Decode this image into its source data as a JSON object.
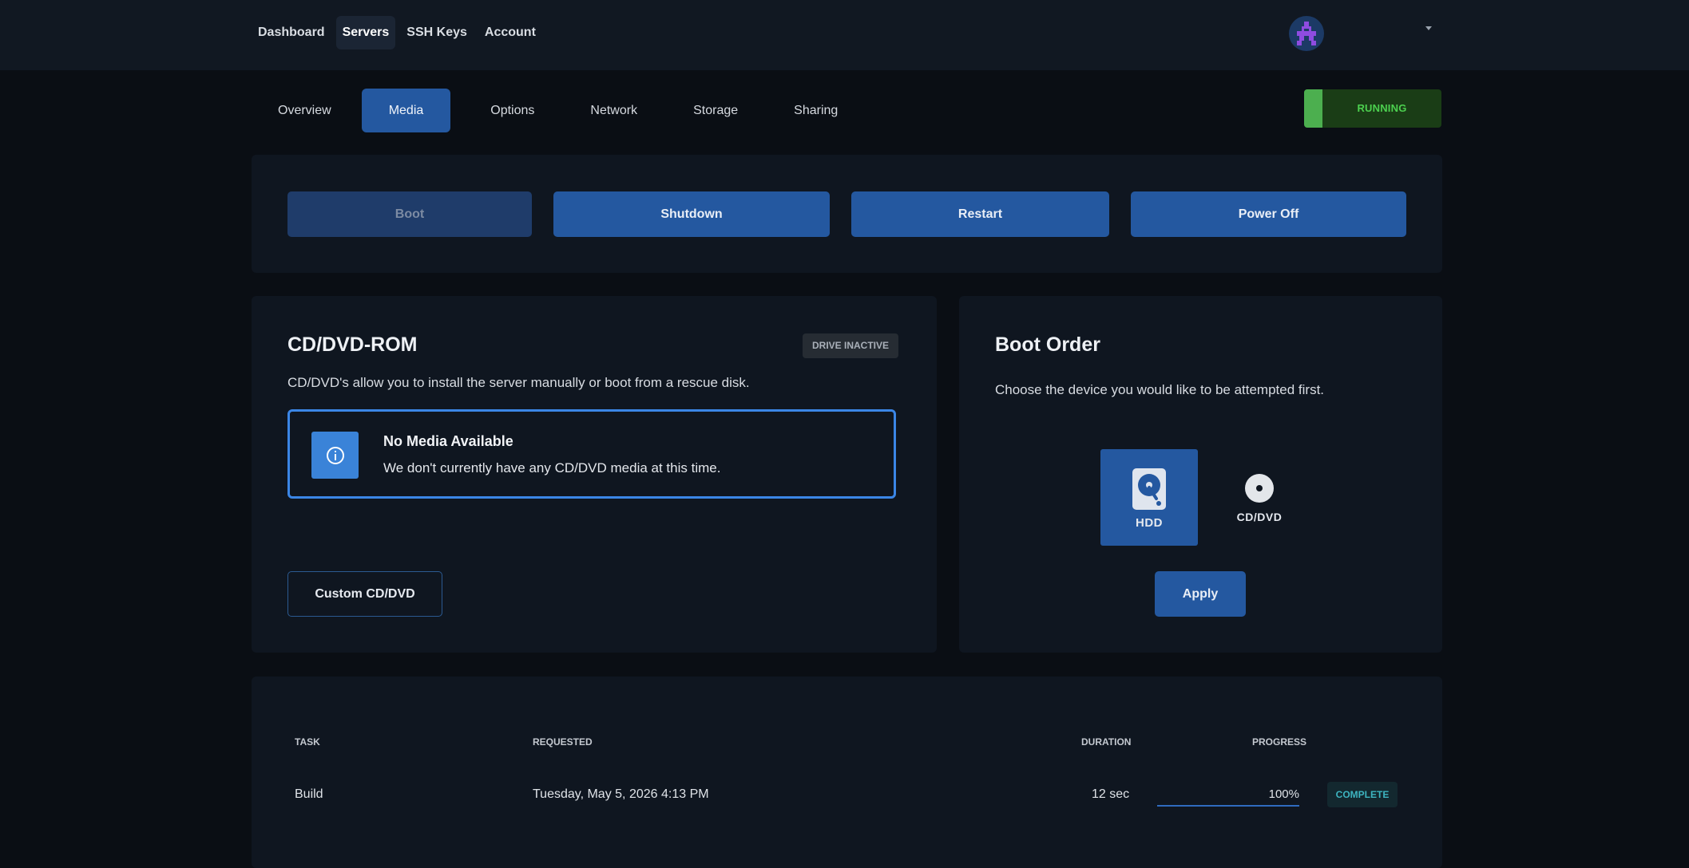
{
  "topnav": {
    "items": [
      {
        "label": "Dashboard"
      },
      {
        "label": "Servers"
      },
      {
        "label": "SSH Keys"
      },
      {
        "label": "Account"
      }
    ],
    "active": "Servers"
  },
  "subtabs": {
    "items": [
      {
        "label": "Overview"
      },
      {
        "label": "Media"
      },
      {
        "label": "Options"
      },
      {
        "label": "Network"
      },
      {
        "label": "Storage"
      },
      {
        "label": "Sharing"
      }
    ],
    "active": "Media"
  },
  "status": {
    "label": "RUNNING",
    "color": "#4cd04f"
  },
  "power": {
    "boot": "Boot",
    "shutdown": "Shutdown",
    "restart": "Restart",
    "power_off": "Power Off"
  },
  "cdrom": {
    "title": "CD/DVD-ROM",
    "badge": "DRIVE INACTIVE",
    "description": "CD/DVD's allow you to install the server manually or boot from a rescue disk.",
    "alert_title": "No Media Available",
    "alert_text": "We don't currently have any CD/DVD media at this time.",
    "custom_button": "Custom CD/DVD"
  },
  "boot_order": {
    "title": "Boot Order",
    "description": "Choose the device you would like to be attempted first.",
    "devices": [
      {
        "label": "HDD",
        "icon": "hard-drive-icon",
        "selected": true
      },
      {
        "label": "CD/DVD",
        "icon": "disc-icon",
        "selected": false
      }
    ],
    "apply": "Apply"
  },
  "tasks": {
    "headers": {
      "task": "TASK",
      "requested": "REQUESTED",
      "duration": "DURATION",
      "progress": "PROGRESS"
    },
    "rows": [
      {
        "task": "Build",
        "requested": "Tuesday, May 5, 2026 4:13 PM",
        "duration": "12 sec",
        "progress": "100%",
        "progress_value": 1.0,
        "status": "COMPLETE"
      }
    ]
  },
  "colors": {
    "accent": "#2458a0",
    "background": "#0a0e14",
    "panel": "#0f1620"
  }
}
